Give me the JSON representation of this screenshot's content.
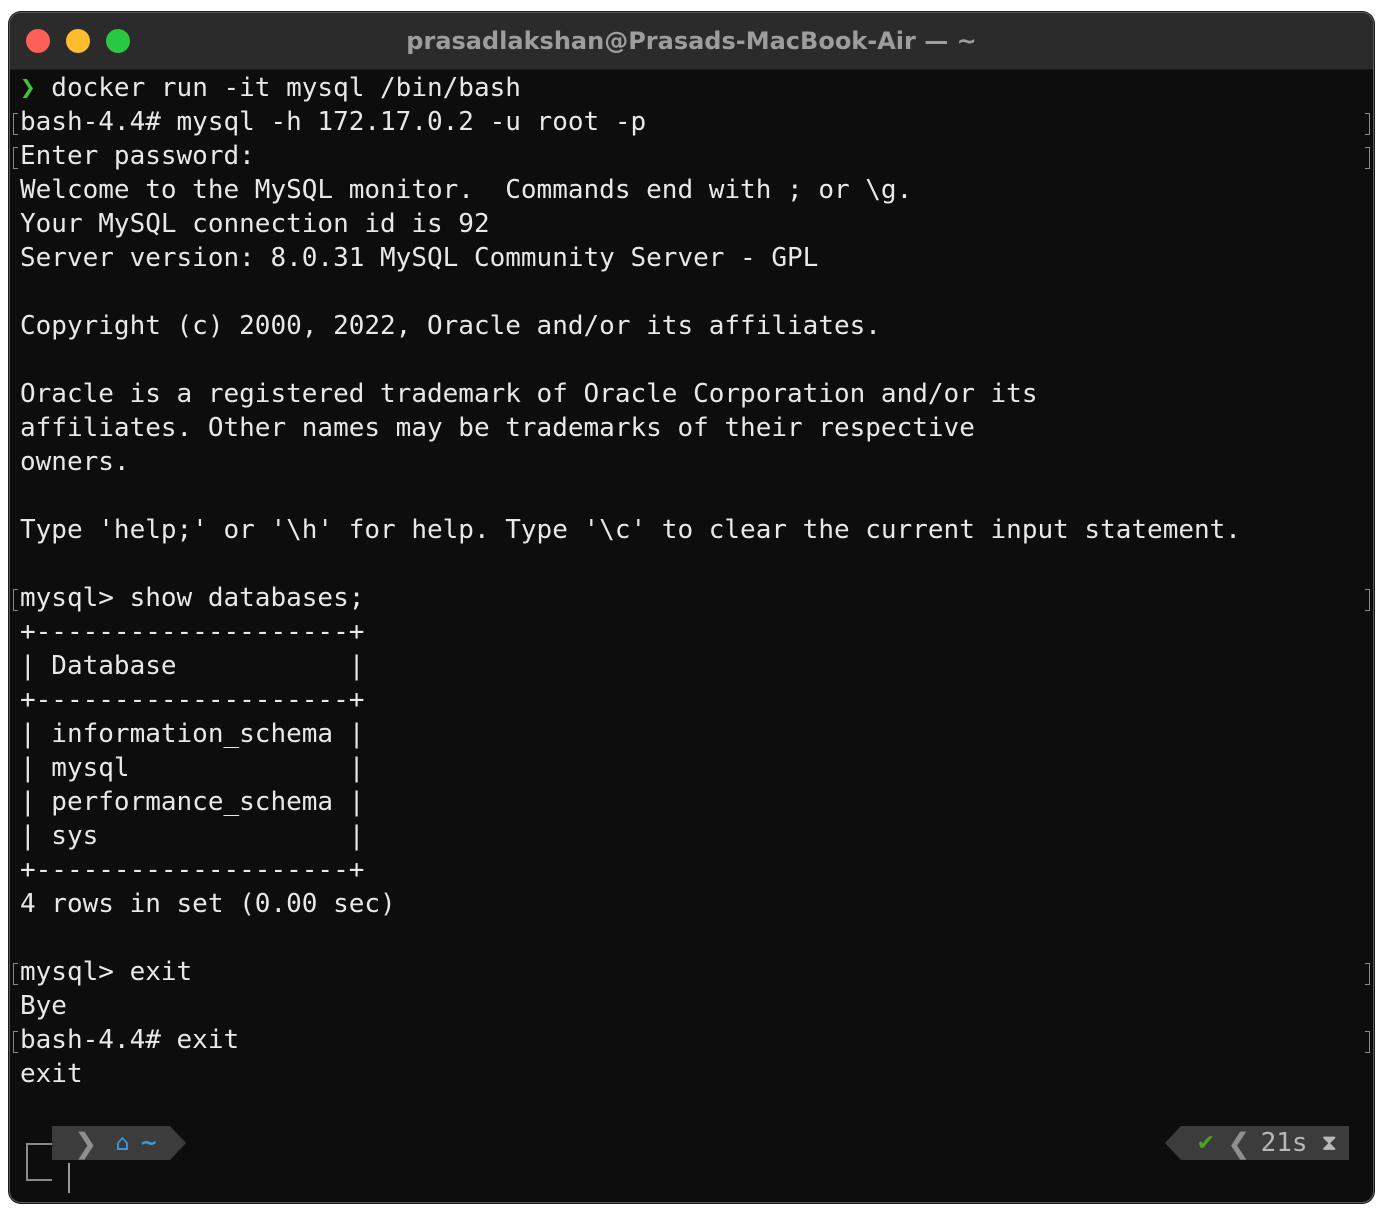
{
  "window": {
    "title": "prasadlakshan@Prasads-MacBook-Air — ~"
  },
  "terminal": {
    "prompt_symbol": "❯",
    "lines": [
      " docker run -it mysql /bin/bash",
      "bash-4.4# mysql -h 172.17.0.2 -u root -p",
      "Enter password:",
      "Welcome to the MySQL monitor.  Commands end with ; or \\g.",
      "Your MySQL connection id is 92",
      "Server version: 8.0.31 MySQL Community Server - GPL",
      "",
      "Copyright (c) 2000, 2022, Oracle and/or its affiliates.",
      "",
      "Oracle is a registered trademark of Oracle Corporation and/or its",
      "affiliates. Other names may be trademarks of their respective",
      "owners.",
      "",
      "Type 'help;' or '\\h' for help. Type '\\c' to clear the current input statement.",
      "",
      "mysql> show databases;",
      "+--------------------+",
      "| Database           |",
      "+--------------------+",
      "| information_schema |",
      "| mysql              |",
      "| performance_schema |",
      "| sys                |",
      "+--------------------+",
      "4 rows in set (0.00 sec)",
      "",
      "mysql> exit",
      "Bye",
      "bash-4.4# exit",
      "exit"
    ]
  },
  "statusbar": {
    "apple_icon": "",
    "home_icon": "⌂",
    "path": "~",
    "check_icon": "✔",
    "duration": "21s",
    "hourglass_icon": "⧗"
  }
}
